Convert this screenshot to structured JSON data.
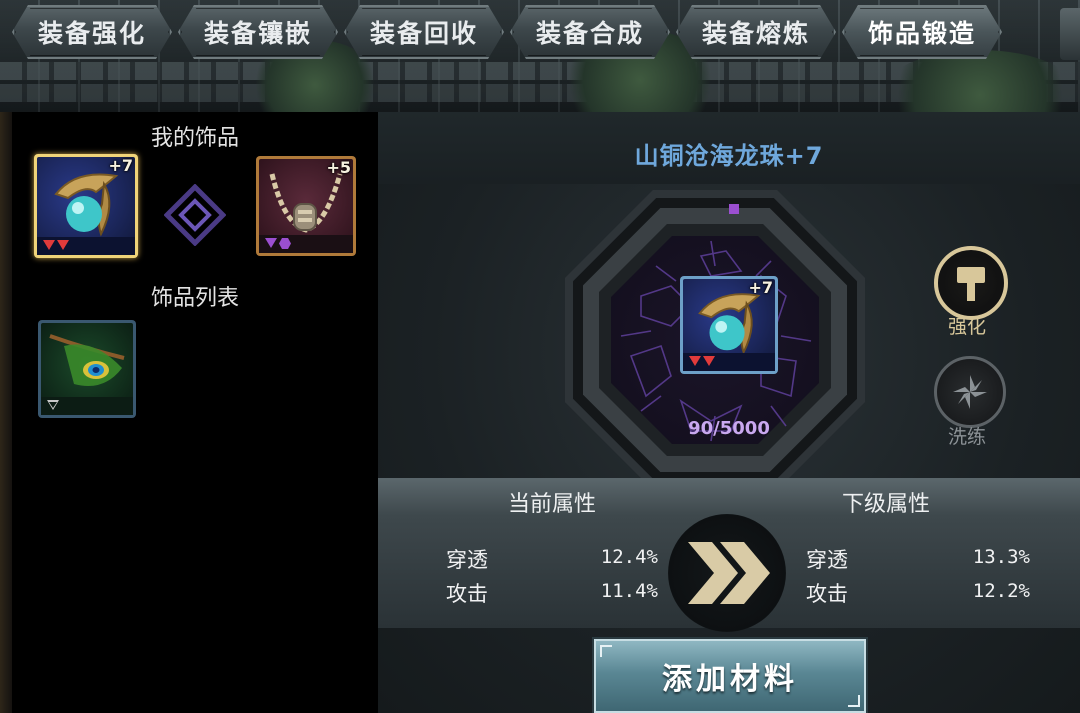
{
  "tabs": [
    {
      "label": "装备强化"
    },
    {
      "label": "装备镶嵌"
    },
    {
      "label": "装备回收"
    },
    {
      "label": "装备合成"
    },
    {
      "label": "装备熔炼"
    },
    {
      "label": "饰品锻造",
      "active": true
    }
  ],
  "left": {
    "my_accessories_title": "我的饰品",
    "accessory_list_title": "饰品列表",
    "equipped": [
      {
        "plus": "+7",
        "quality": "blue",
        "icon": "dragon-pearl-icon"
      },
      {
        "plus": "+5",
        "quality": "orange",
        "icon": "necklace-icon"
      }
    ],
    "list_items": [
      {
        "icon": "peacock-feather-icon"
      }
    ]
  },
  "forge": {
    "item_name": "山铜沧海龙珠+7",
    "item_plus": "+7",
    "progress_text": "90/5000",
    "enhance_label": "强化",
    "refine_label": "洗练"
  },
  "attributes": {
    "current_title": "当前属性",
    "next_title": "下级属性",
    "current": [
      {
        "name": "穿透",
        "value": "12.4%"
      },
      {
        "name": "攻击",
        "value": "11.4%"
      }
    ],
    "next": [
      {
        "name": "穿透",
        "value": "13.3%"
      },
      {
        "name": "攻击",
        "value": "12.2%"
      }
    ]
  },
  "add_material_label": "添加材料",
  "colors": {
    "title_blue": "#6fa8dc",
    "progress_purple": "#c9a8ef",
    "gold": "#d8c79a",
    "button_teal": "#5a8794"
  }
}
